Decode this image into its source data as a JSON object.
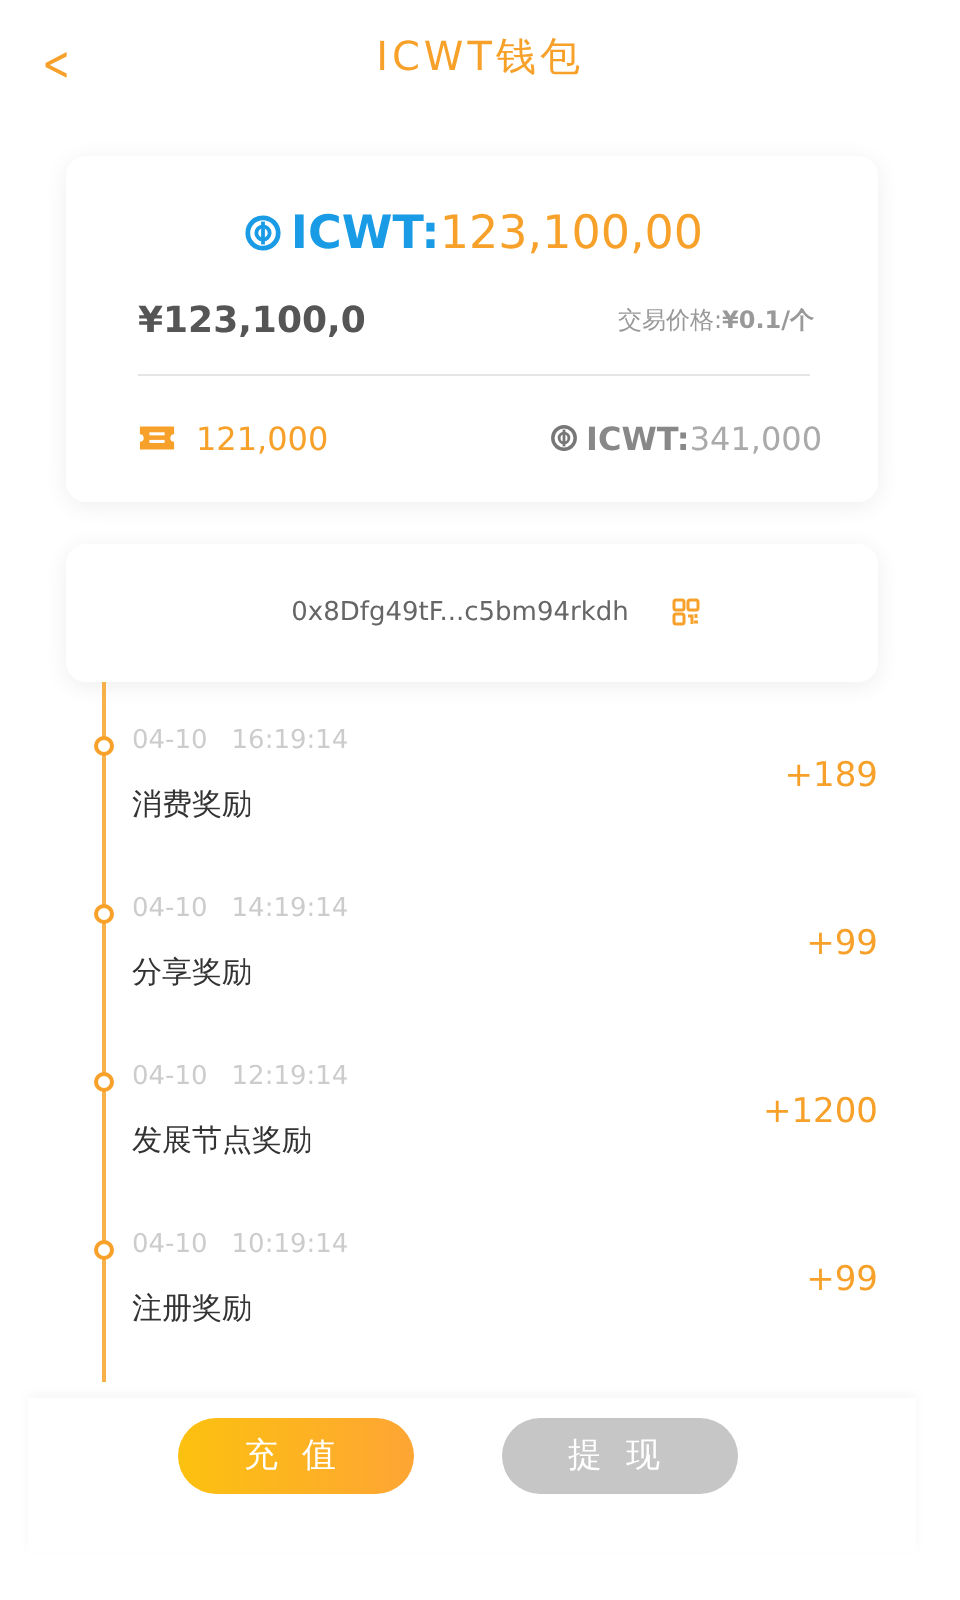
{
  "header": {
    "back": "<",
    "title": "ICWT钱包"
  },
  "balance": {
    "token_label": "ICWT:",
    "token_amount": "123,100,00",
    "fiat": "¥123,100,0",
    "price_label": "交易价格:",
    "price_value": "¥0.1/个",
    "tickets": "121,000",
    "sub_token_label": "ICWT:",
    "sub_token_amount": "341,000"
  },
  "address": "0x8Dfg49tF...c5bm94rkdh",
  "records": [
    {
      "date": "04-10",
      "time": "16:19:14",
      "title": "消费奖励",
      "amount": "+189"
    },
    {
      "date": "04-10",
      "time": "14:19:14",
      "title": "分享奖励",
      "amount": "+99"
    },
    {
      "date": "04-10",
      "time": "12:19:14",
      "title": "发展节点奖励",
      "amount": "+1200"
    },
    {
      "date": "04-10",
      "time": "10:19:14",
      "title": "注册奖励",
      "amount": "+99"
    }
  ],
  "buttons": [
    {
      "label": "充值",
      "disabled": false
    },
    {
      "label": "提现",
      "disabled": true
    }
  ]
}
